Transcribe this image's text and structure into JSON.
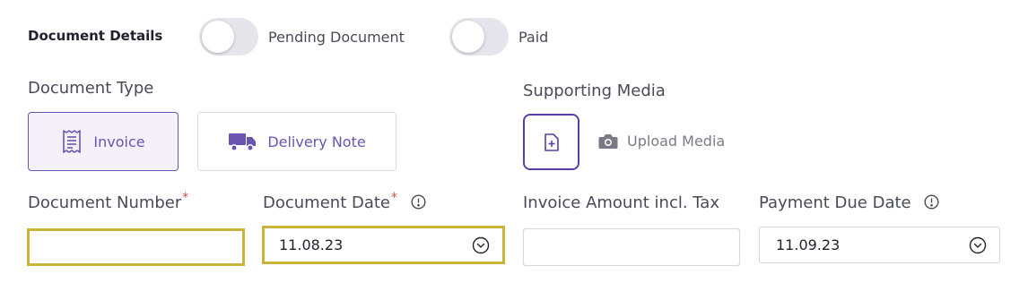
{
  "section": {
    "title": "Document Details",
    "toggles": [
      {
        "label": "Pending Document",
        "on": false
      },
      {
        "label": "Paid",
        "on": false
      }
    ]
  },
  "document_type": {
    "label": "Document Type",
    "options": [
      {
        "label": "Invoice",
        "icon": "receipt-icon",
        "selected": true
      },
      {
        "label": "Delivery Note",
        "icon": "truck-icon",
        "selected": false
      }
    ]
  },
  "supporting_media": {
    "label": "Supporting Media",
    "upload_label": "Upload Media",
    "icons": [
      "file-plus-icon",
      "camera-icon"
    ]
  },
  "fields": {
    "document_number": {
      "label": "Document Number",
      "required": "*",
      "value": ""
    },
    "document_date": {
      "label": "Document Date",
      "required": "*",
      "value": "11.08.23"
    },
    "invoice_amount": {
      "label": "Invoice Amount incl. Tax",
      "value": ""
    },
    "payment_due_date": {
      "label": "Payment Due Date",
      "value": "11.09.23"
    }
  },
  "colors": {
    "accent": "#6a55b0",
    "accent_dark": "#5b3ea8",
    "highlight_border": "#c9b43a",
    "required": "#c0504d"
  }
}
